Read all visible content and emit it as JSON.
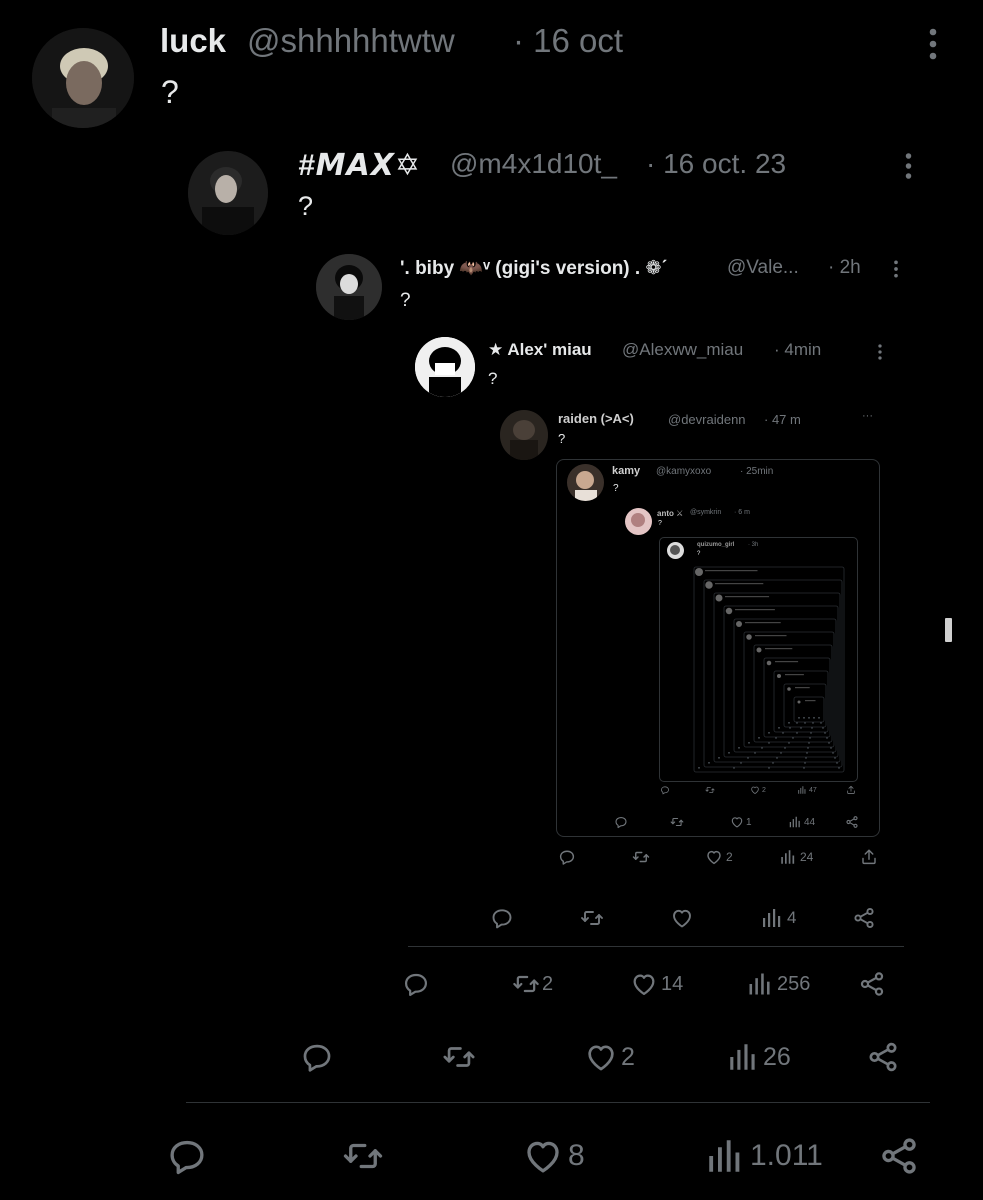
{
  "tweets": [
    {
      "name": "luck",
      "handle": "@shhhhhtwtw",
      "date": "· 16 oct",
      "text": "?",
      "replies": "",
      "retweets": "",
      "likes": "8",
      "views": "1.011"
    },
    {
      "name": "#𝙈𝘼𝙓✡︎",
      "handle": "@m4x1d10t_",
      "date": "· 16 oct. 23",
      "text": "?",
      "replies": "",
      "retweets": "",
      "likes": "2",
      "views": "26"
    },
    {
      "name": "'. biby 🦇ᵛ (gigi's version) . ❁ˊ",
      "handle": "@Vale...",
      "date": "· 2h",
      "text": "?",
      "replies": "",
      "retweets": "2",
      "likes": "14",
      "views": "256"
    },
    {
      "name": "★ Alex' miau",
      "handle": "@Alexww_miau",
      "date": "· 4min",
      "text": "?",
      "replies": "",
      "retweets": "",
      "likes": "",
      "views": "4"
    },
    {
      "name": "raiden (>A<)",
      "handle": "@devraidenn",
      "date": "· 47 m",
      "text": "?",
      "replies": "",
      "retweets": "",
      "likes": "2",
      "views": "24"
    },
    {
      "name": "kamy",
      "handle": "@kamyxoxo",
      "date": "· 25min",
      "text": "?",
      "replies": "",
      "retweets": "",
      "likes": "1",
      "views": "44"
    },
    {
      "name": "anto ⚔",
      "handle": "@symkrin",
      "date": "· 6 m",
      "text": "?",
      "likes": "2",
      "views": "47"
    },
    {
      "name": "quizumo_girl",
      "date": "· 3h",
      "text": "?",
      "views": "2"
    }
  ],
  "icons": {
    "reply": "reply-icon",
    "retweet": "retweet-icon",
    "like": "heart-icon",
    "views": "views-icon",
    "share": "share-icon",
    "more": "more-icon"
  },
  "colors": {
    "background": "#000000",
    "text": "#e7e9ea",
    "muted": "#71767b",
    "divider": "#2f3336"
  }
}
